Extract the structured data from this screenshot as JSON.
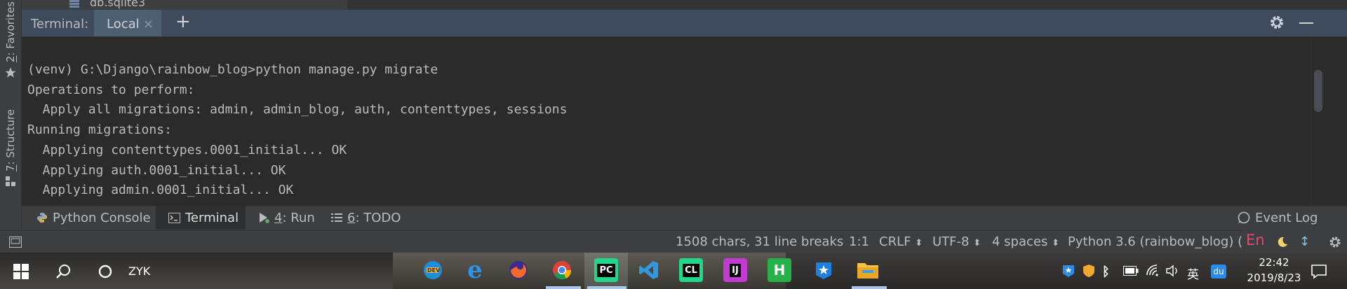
{
  "project": {
    "file_name": "db.sqlite3"
  },
  "left_strip": {
    "favorites": {
      "num": "2",
      "label": ": Favorites"
    },
    "structure": {
      "num": "7",
      "label": ": Structure"
    }
  },
  "terminal": {
    "title": "Terminal:",
    "tab_label": "Local",
    "close_glyph": "×",
    "add_glyph": "+",
    "lines": [
      "(venv) G:\\Django\\rainbow_blog>python manage.py migrate",
      "Operations to perform:",
      "  Apply all migrations: admin, admin_blog, auth, contenttypes, sessions",
      "Running migrations:",
      "  Applying contenttypes.0001_initial... OK",
      "  Applying auth.0001_initial... OK",
      "  Applying admin.0001_initial... OK"
    ]
  },
  "tool_tabs": {
    "python_console": "Python Console",
    "terminal": "Terminal",
    "run_num": "4",
    "run_label": ": Run",
    "todo_num": "6",
    "todo_label": ": TODO",
    "event_log": "Event Log"
  },
  "status": {
    "chars": "1508 chars, 31 line breaks",
    "position": "1:1",
    "line_sep": "CRLF",
    "encoding": "UTF-8",
    "indent": "4 spaces",
    "interpreter": "Python 3.6 (rainbow_blog) (2",
    "ime": "En",
    "spinner_glyph": "↕"
  },
  "taskbar": {
    "user": "ZYK",
    "apps": [
      "DEV-edge",
      "edge",
      "firefox",
      "chrome",
      "pycharm",
      "vscode",
      "clion",
      "intellij",
      "hbuilder",
      "star-app",
      "explorer"
    ],
    "app_labels": {
      "dev": "DEV",
      "edge": "e",
      "pycharm": "PC",
      "clion": "CL",
      "intellij": "IJ",
      "hbuilder": "H"
    },
    "ime_glyph": "英",
    "du_glyph": "du",
    "time": "22:42",
    "date": "2019/8/23"
  },
  "colors": {
    "ide_bg": "#2b2b2b",
    "panel": "#3c3f41",
    "terminal_header": "#3d4b5c",
    "text": "#bbbbbb",
    "ime_red": "#e64a6e"
  }
}
